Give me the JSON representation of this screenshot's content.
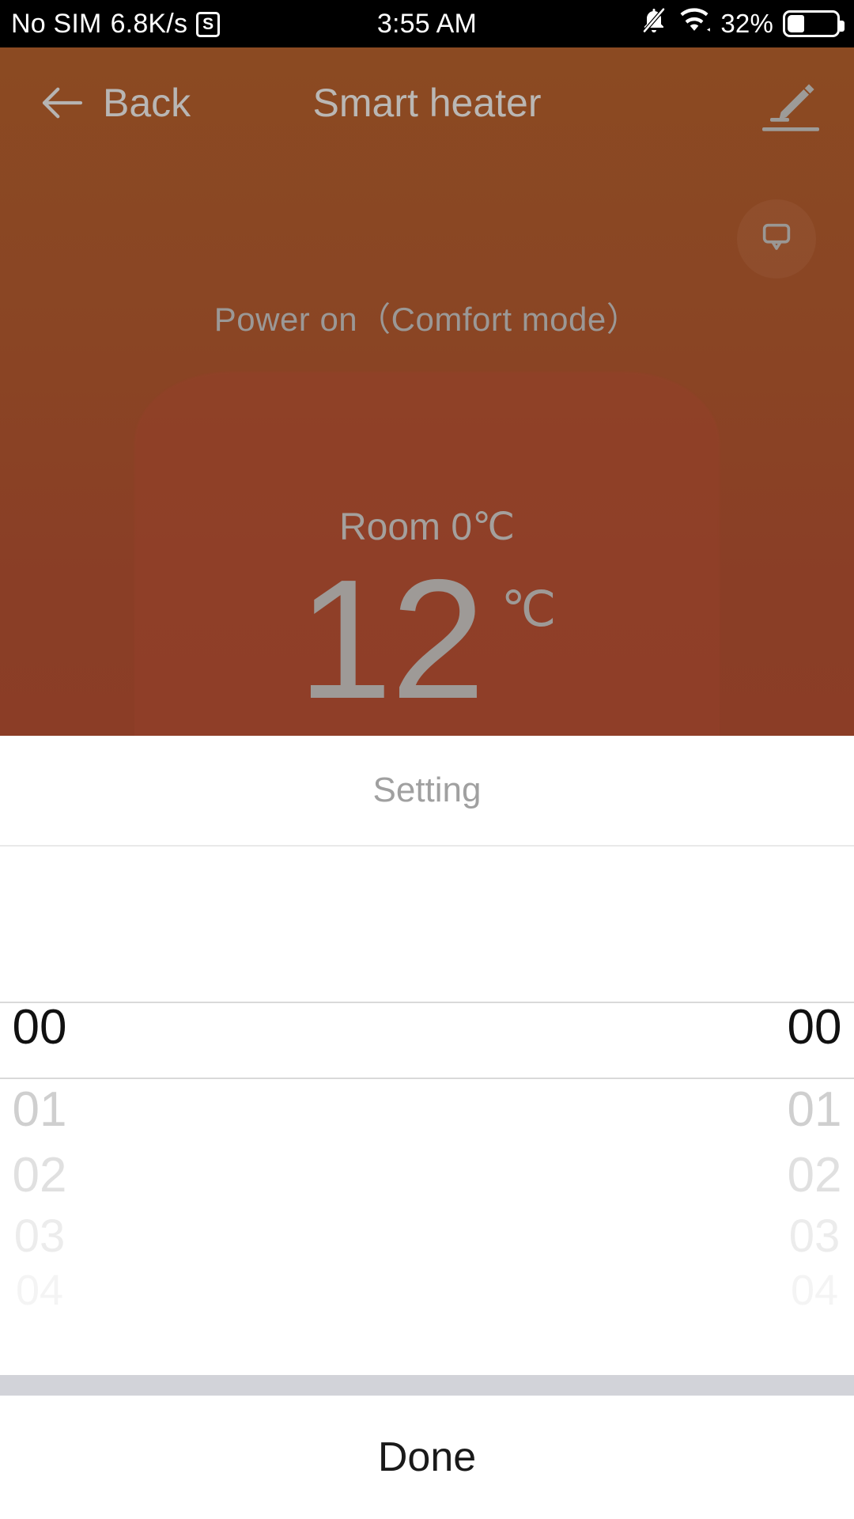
{
  "statusbar": {
    "carrier": "No SIM",
    "netspeed": "6.8K/s",
    "sim_badge": "S",
    "time": "3:55 AM",
    "battery_percent": "32%",
    "battery_level": 32,
    "icons": [
      "bell-muted-icon",
      "wifi-icon",
      "battery-icon"
    ]
  },
  "navbar": {
    "back_label": "Back",
    "title": "Smart heater",
    "edit_icon": "pencil-icon"
  },
  "hero": {
    "status_text": "Power on（Comfort mode）",
    "display_icon": "monitor-icon",
    "room_label": "Room 0℃",
    "target_temp": "12",
    "target_unit": "℃",
    "background_color": "#8b4a22"
  },
  "sheet": {
    "title": "Setting",
    "picker": {
      "columns": [
        {
          "name": "hours",
          "selected": "00",
          "items": [
            "00",
            "01",
            "02",
            "03",
            "04"
          ]
        },
        {
          "name": "minutes",
          "selected": "00",
          "items": [
            "00",
            "01",
            "02",
            "03",
            "04"
          ]
        }
      ]
    },
    "done_label": "Done"
  }
}
